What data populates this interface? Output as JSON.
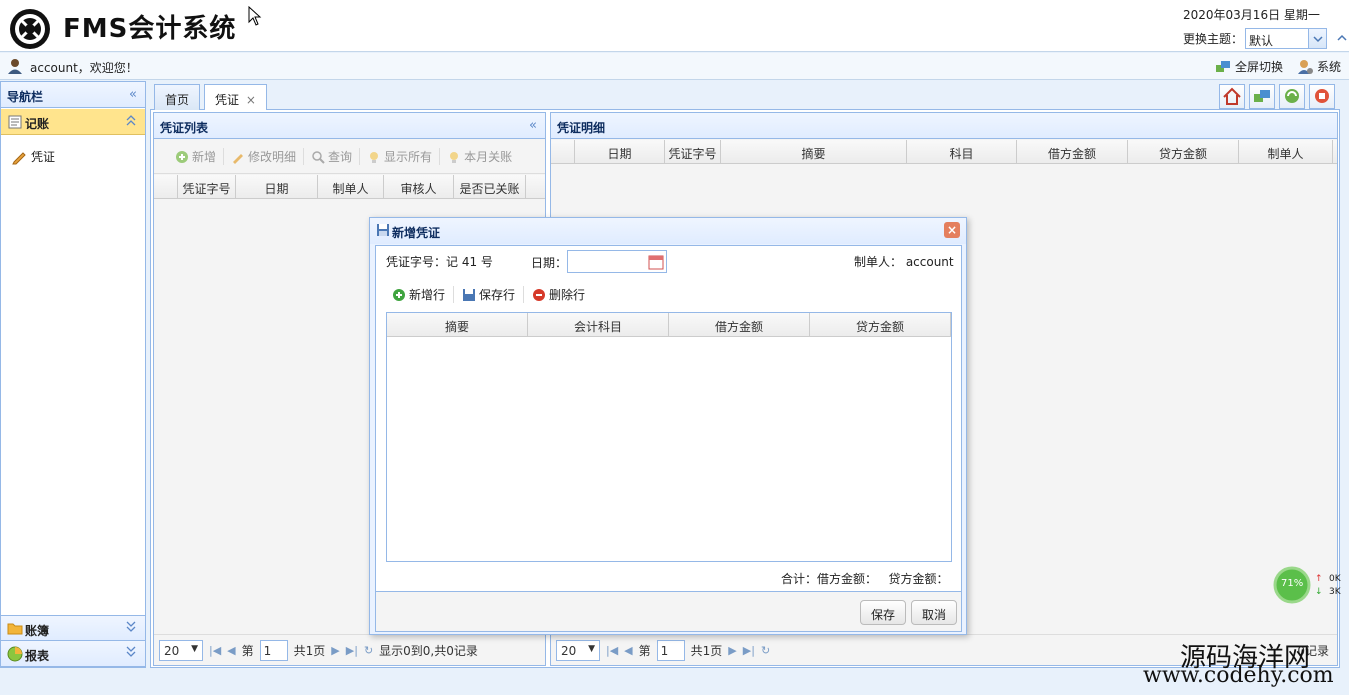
{
  "header": {
    "app_title": "FMS会计系统",
    "date": "2020年03月16日 星期一",
    "theme_label": "更换主题：",
    "theme_value": "默认"
  },
  "userbar": {
    "welcome": "account，欢迎您！",
    "fullscreen": "全屏切换",
    "system": "系统"
  },
  "nav": {
    "title": "导航栏",
    "accounting": "记账",
    "voucher_item": "凭证",
    "ledger": "账簿",
    "report": "报表"
  },
  "tabs": {
    "home": "首页",
    "voucher": "凭证",
    "close": "×"
  },
  "voucher_list": {
    "title": "凭证列表",
    "toolbar": [
      "新增",
      "修改明细",
      "查询",
      "显示所有",
      "本月关账"
    ],
    "columns": [
      "凭证字号",
      "日期",
      "制单人",
      "审核人",
      "是否已关账"
    ],
    "pager": {
      "page_size": "20",
      "page_prefix": "第",
      "page": "1",
      "page_total": "共1页",
      "info": "显示0到0,共0记录"
    }
  },
  "voucher_detail": {
    "title": "凭证明细",
    "columns": [
      "日期",
      "凭证字号",
      "摘要",
      "科目",
      "借方金额",
      "贷方金额",
      "制单人"
    ],
    "pager": {
      "page_size": "20",
      "page_prefix": "第",
      "page": "1",
      "page_total": "共1页",
      "info": "0记录"
    }
  },
  "modal": {
    "title": "新增凭证",
    "voucher_no": "凭证字号：记 41 号",
    "date_label": "日期：",
    "maker": "制单人： account",
    "toolbar": [
      "新增行",
      "保存行",
      "删除行"
    ],
    "columns": [
      "摘要",
      "会计科目",
      "借方金额",
      "贷方金额"
    ],
    "total": "合计：借方金额：   贷方金额：",
    "save": "保存",
    "cancel": "取消"
  },
  "widget": {
    "percent": "71%",
    "up": "0K",
    "down": "3K"
  },
  "watermark": {
    "line1": "源码海洋网",
    "line2": "www.codehy.com"
  }
}
